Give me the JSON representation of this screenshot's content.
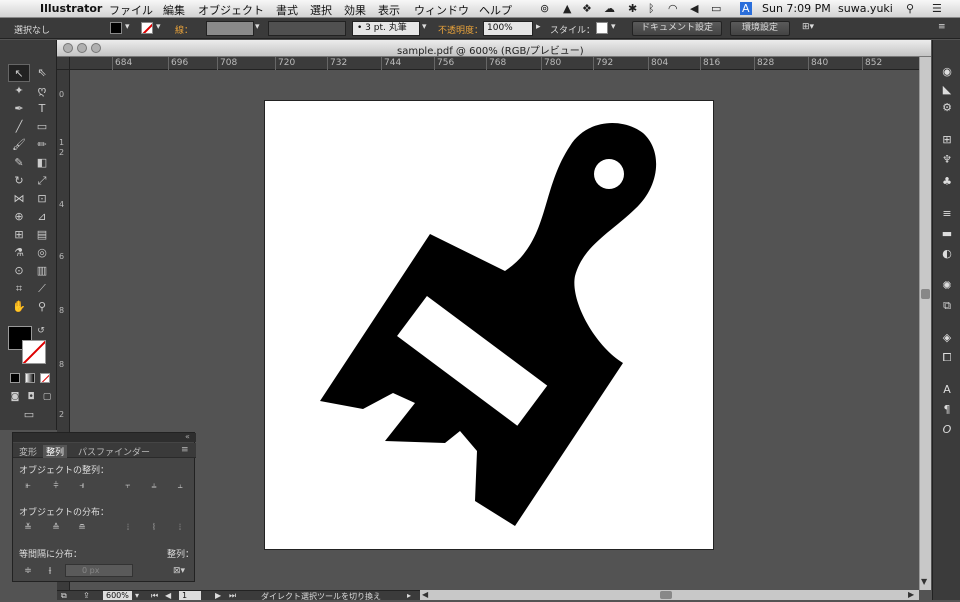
{
  "menubar": {
    "app_name": "Illustrator",
    "items": [
      "ファイル",
      "編集",
      "オブジェクト",
      "書式",
      "選択",
      "効果",
      "表示",
      "ウィンドウ",
      "ヘルプ"
    ],
    "clock": "Sun 7:09 PM",
    "user": "suwa.yuki"
  },
  "control_bar": {
    "selection_status": "選択なし",
    "stroke_label": "線：",
    "brush_value": "• 3 pt. 丸筆",
    "opacity_label": "不透明度：",
    "opacity_value": "100%",
    "style_label": "スタイル：",
    "doc_settings": "ドキュメント設定",
    "prefs": "環境設定"
  },
  "window": {
    "title": "sample.pdf @ 600% (RGB/プレビュー)"
  },
  "ruler": {
    "h_ticks": [
      "684",
      "696",
      "708",
      "720",
      "732",
      "744",
      "756",
      "768",
      "780",
      "792",
      "804",
      "816",
      "828",
      "840",
      "852"
    ],
    "v_ticks": [
      "0",
      "1",
      "2",
      "4",
      "6",
      "8",
      "8",
      "2"
    ]
  },
  "align_panel": {
    "tabs": [
      "変形",
      "整列",
      "パスファインダー"
    ],
    "align_objects": "オブジェクトの整列：",
    "distribute_objects": "オブジェクトの分布：",
    "distribute_spacing": "等間隔に分布：",
    "align_to": "整列：",
    "spacing_value": "0 px"
  },
  "status": {
    "zoom": "600%",
    "page": "1",
    "tool_hint": "ダイレクト選択ツールを切り換え"
  }
}
